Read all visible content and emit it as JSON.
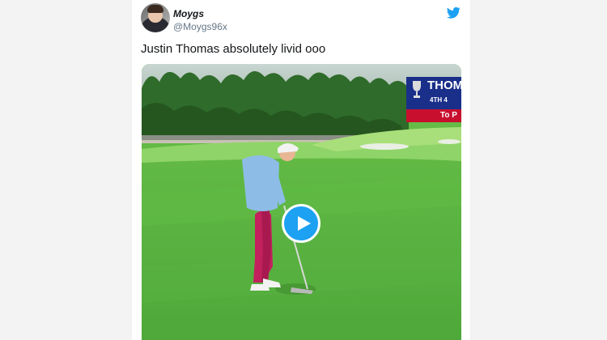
{
  "tweet": {
    "display_name": "Moygs",
    "handle": "@Moygs96x",
    "text": "Justin Thomas absolutely livid ooo"
  },
  "icons": {
    "brand": "twitter-bird-icon",
    "play": "play-icon"
  },
  "media": {
    "scoreboard": {
      "player": "THOM",
      "position": "4TH  4",
      "to_par_label": "To P"
    }
  },
  "colors": {
    "twitter_blue": "#1da1f2",
    "text_primary": "#14171a",
    "text_secondary": "#657786",
    "scoreboard_blue": "#1a2f8a",
    "scoreboard_red": "#c8102e"
  }
}
